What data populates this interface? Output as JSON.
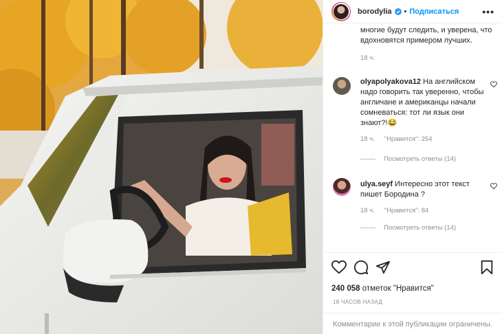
{
  "header": {
    "username": "borodylia",
    "separator": "•",
    "follow_label": "Подписаться",
    "more_label": "•••",
    "verified_color": "#3897f0"
  },
  "comments": [
    {
      "text_continued": "многие будут следить, и уверена, что вдохновятся примером лучших.",
      "time": "18 ч."
    },
    {
      "username": "olyapolyakova12",
      "text": "На английском надо говорить так уверенно, чтобы англичане и американцы начали сомневаться: тот ли язык они знают?!😂",
      "time": "18 ч.",
      "likes": "\"Нравится\": 254",
      "replies": "Посмотреть ответы (14)"
    },
    {
      "username": "ulya.seyf",
      "text": "Интересно этот текст пишет Бородина ?",
      "time": "18 ч.",
      "likes": "\"Нравится\": 84",
      "replies": "Посмотреть ответы (14)"
    }
  ],
  "actions": {
    "icons": [
      "heart-icon",
      "comment-icon",
      "share-icon",
      "bookmark-icon"
    ],
    "likes_count": "240 058",
    "likes_label": "отметок \"Нравится\"",
    "time_ago": "18 ЧАСОВ НАЗАД",
    "comments_restricted": "Комментарии к этой публикации ограничены."
  },
  "colors": {
    "accent": "#0095f6",
    "text": "#262626",
    "secondary": "#8e8e8e",
    "border": "#efefef"
  }
}
